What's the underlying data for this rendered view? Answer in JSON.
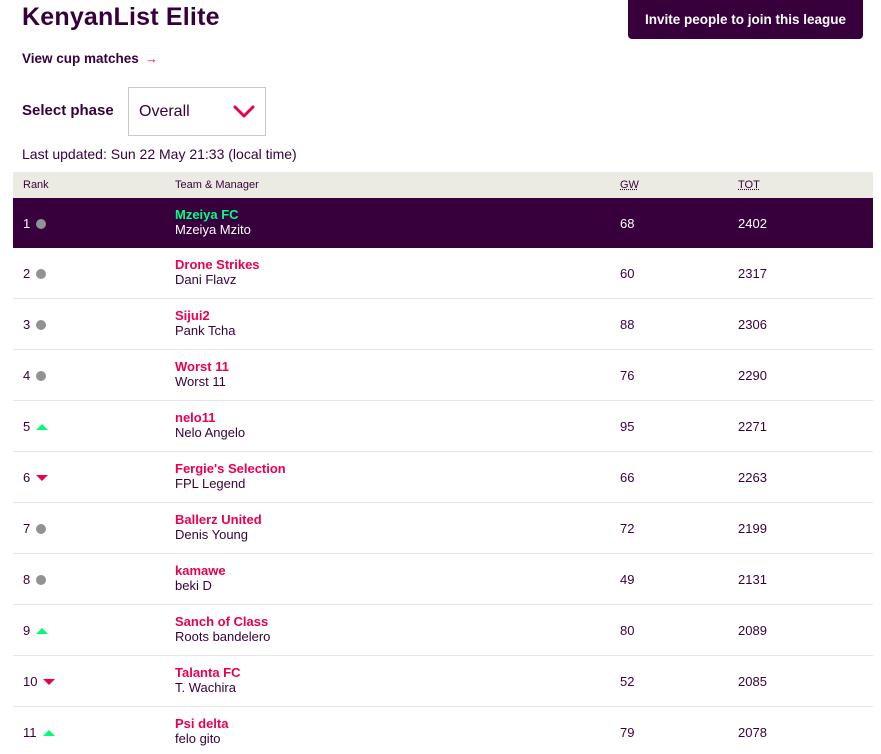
{
  "header": {
    "title": "KenyanList Elite",
    "invite_label": "Invite people to join this league",
    "cup_link_label": "View cup matches",
    "cup_link_arrow": "→"
  },
  "phase": {
    "label": "Select phase",
    "selected": "Overall"
  },
  "last_updated": "Last updated: Sun 22 May 21:33 (local time)",
  "columns": {
    "rank": "Rank",
    "team": "Team & Manager",
    "gw": "GW",
    "tot": "TOT"
  },
  "colors": {
    "primary": "#37003c",
    "accent": "#e90052",
    "highlight_green": "#00ff85",
    "up_green": "#01fc7a",
    "same_grey": "#929292"
  },
  "rows": [
    {
      "rank": "1",
      "movement": "same",
      "team": "Mzeiya FC",
      "manager": "Mzeiya Mzito",
      "gw": "68",
      "tot": "2402",
      "active": true
    },
    {
      "rank": "2",
      "movement": "same",
      "team": "Drone Strikes",
      "manager": "Dani Flavz",
      "gw": "60",
      "tot": "2317"
    },
    {
      "rank": "3",
      "movement": "same",
      "team": "Sijui2",
      "manager": "Pank Tcha",
      "gw": "88",
      "tot": "2306"
    },
    {
      "rank": "4",
      "movement": "same",
      "team": "Worst 11",
      "manager": "Worst 11",
      "gw": "76",
      "tot": "2290"
    },
    {
      "rank": "5",
      "movement": "up",
      "team": "nelo11",
      "manager": "Nelo Angelo",
      "gw": "95",
      "tot": "2271"
    },
    {
      "rank": "6",
      "movement": "down",
      "team": "Fergie's Selection",
      "manager": "FPL Legend",
      "gw": "66",
      "tot": "2263"
    },
    {
      "rank": "7",
      "movement": "same",
      "team": "Ballerz United",
      "manager": "Denis Young",
      "gw": "72",
      "tot": "2199"
    },
    {
      "rank": "8",
      "movement": "same",
      "team": "kamawe",
      "manager": "beki D",
      "gw": "49",
      "tot": "2131"
    },
    {
      "rank": "9",
      "movement": "up",
      "team": "Sanch of Class",
      "manager": "Roots bandelero",
      "gw": "80",
      "tot": "2089"
    },
    {
      "rank": "10",
      "movement": "down",
      "team": "Talanta FC",
      "manager": "T. Wachira",
      "gw": "52",
      "tot": "2085"
    },
    {
      "rank": "11",
      "movement": "up",
      "team": "Psi delta",
      "manager": "felo gito",
      "gw": "79",
      "tot": "2078"
    }
  ]
}
